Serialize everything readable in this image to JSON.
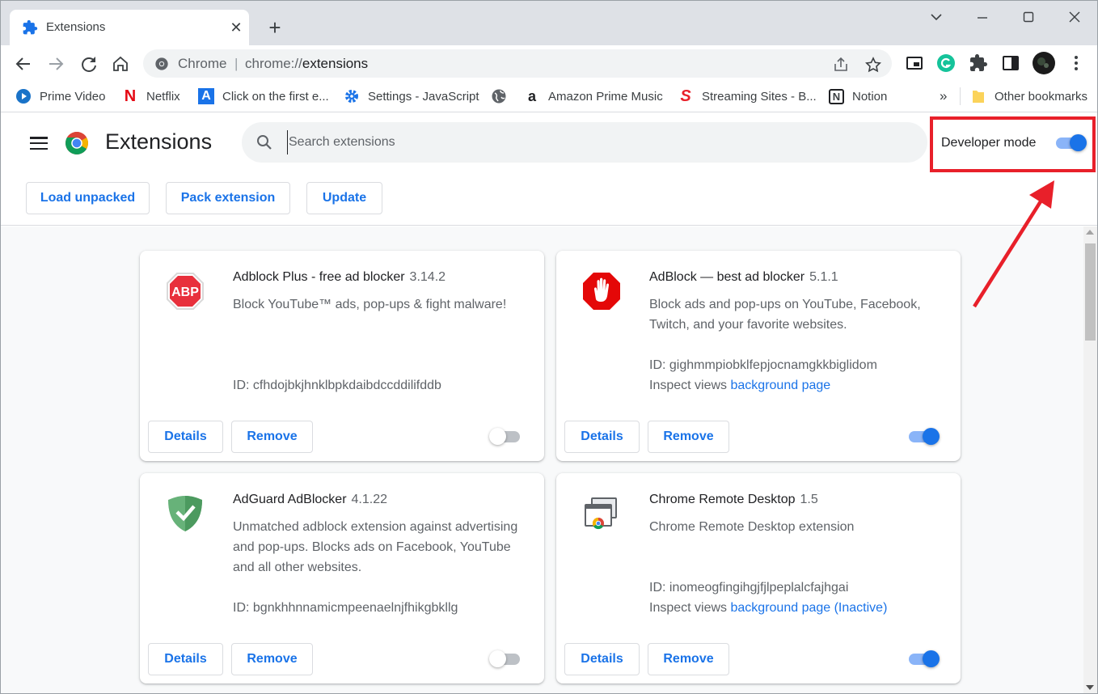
{
  "colors": {
    "accent": "#1a73e8",
    "annotation": "#e8202a",
    "toggle_on": "#1a73e8"
  },
  "tab": {
    "title": "Extensions",
    "icon": "puzzle-icon"
  },
  "omnibox": {
    "scheme_label": "Chrome",
    "separator": "|",
    "url_scheme": "chrome://",
    "url_path": "extensions"
  },
  "bookmarks": [
    {
      "label": "Prime Video",
      "icon": "prime-video-icon"
    },
    {
      "label": "Netflix",
      "icon": "netflix-icon"
    },
    {
      "label": "Click on the first e...",
      "icon": "a-icon"
    },
    {
      "label": "Settings - JavaScript",
      "icon": "gear-icon"
    },
    {
      "label": "",
      "icon": "globe-icon"
    },
    {
      "label": "Amazon Prime Music",
      "icon": "amazon-icon"
    },
    {
      "label": "Streaming Sites - B...",
      "icon": "s-icon"
    },
    {
      "label": "Notion",
      "icon": "notion-icon"
    }
  ],
  "bookmarks_overflow": "»",
  "other_bookmarks": "Other bookmarks",
  "header": {
    "title": "Extensions",
    "search_placeholder": "Search extensions",
    "developer_mode_label": "Developer mode",
    "developer_mode_on": true,
    "buttons": {
      "load_unpacked": "Load unpacked",
      "pack_extension": "Pack extension",
      "update": "Update"
    }
  },
  "cards": [
    {
      "name": "Adblock Plus - free ad blocker",
      "version": "3.14.2",
      "description": "Block YouTube™ ads, pop-ups & fight malware!",
      "id": "ID: cfhdojbkjhnklbpkdaibdccddilifddb",
      "inspect_label": "",
      "inspect_link": "",
      "enabled": false,
      "logo": "abp-logo-icon",
      "logo_text": "ABP",
      "details": "Details",
      "remove": "Remove"
    },
    {
      "name": "AdBlock — best ad blocker",
      "version": "5.1.1",
      "description": "Block ads and pop-ups on YouTube, Facebook, Twitch, and your favorite websites.",
      "id": "ID: gighmmpiobklfepjocnamgkkbiglidom",
      "inspect_label": "Inspect views",
      "inspect_link": "background page",
      "enabled": true,
      "logo": "adblock-hand-icon",
      "details": "Details",
      "remove": "Remove"
    },
    {
      "name": "AdGuard AdBlocker",
      "version": "4.1.22",
      "description": "Unmatched adblock extension against advertising and pop-ups. Blocks ads on Facebook, YouTube and all other websites.",
      "id": "ID: bgnkhhnnamicmpeenaelnjfhikgbkllg",
      "inspect_label": "",
      "inspect_link": "",
      "enabled": false,
      "logo": "adguard-shield-icon",
      "details": "Details",
      "remove": "Remove"
    },
    {
      "name": "Chrome Remote Desktop",
      "version": "1.5",
      "description": "Chrome Remote Desktop extension",
      "id": "ID: inomeogfingihgjfjlpeplalcfajhgai",
      "inspect_label": "Inspect views",
      "inspect_link": "background page (Inactive)",
      "enabled": true,
      "logo": "remote-desktop-icon",
      "details": "Details",
      "remove": "Remove"
    }
  ]
}
